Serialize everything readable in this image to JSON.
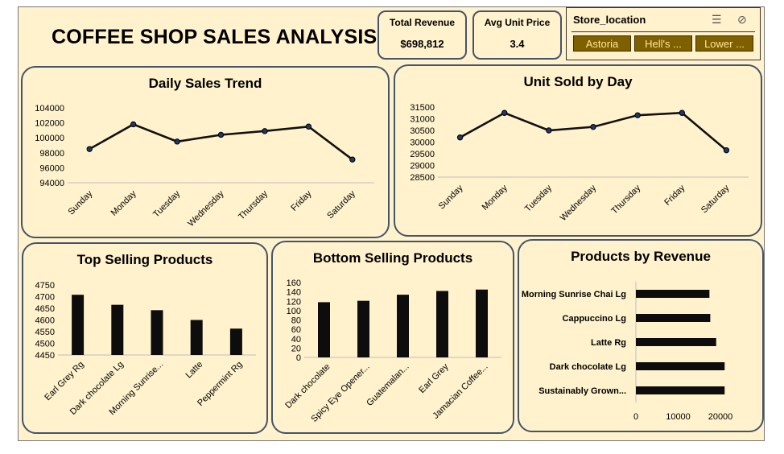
{
  "dashboard_title": "COFFEE SHOP SALES ANALYSIS",
  "kpis": {
    "total_revenue": {
      "label": "Total Revenue",
      "value": "$698,812"
    },
    "avg_unit_price": {
      "label": "Avg Unit Price",
      "value": "3.4"
    }
  },
  "slicer": {
    "header": "Store_location",
    "items": [
      "Astoria",
      "Hell's ...",
      "Lower ..."
    ]
  },
  "charts": {
    "daily_sales": {
      "title": "Daily Sales Trend"
    },
    "units_by_day": {
      "title": "Unit Sold by Day"
    },
    "top_products": {
      "title": "Top Selling Products"
    },
    "bottom_products": {
      "title": "Bottom Selling Products"
    },
    "products_revenue": {
      "title": "Products by Revenue"
    }
  },
  "chart_data": [
    {
      "id": "daily_sales",
      "type": "line",
      "title": "Daily Sales Trend",
      "categories": [
        "Sunday",
        "Monday",
        "Tuesday",
        "Wednesday",
        "Thursday",
        "Friday",
        "Saturday"
      ],
      "values": [
        98500,
        101800,
        99500,
        100400,
        100900,
        101500,
        97100
      ],
      "ylim": [
        94000,
        104000
      ],
      "yticks": [
        94000,
        96000,
        98000,
        100000,
        102000,
        104000
      ],
      "grid": false
    },
    {
      "id": "units_by_day",
      "type": "line",
      "title": "Unit Sold by Day",
      "categories": [
        "Sunday",
        "Monday",
        "Tuesday",
        "Wednesday",
        "Thursday",
        "Friday",
        "Saturday"
      ],
      "values": [
        30200,
        31250,
        30500,
        30650,
        31150,
        31250,
        29650
      ],
      "ylim": [
        28500,
        31500
      ],
      "yticks": [
        28500,
        29000,
        29500,
        30000,
        30500,
        31000,
        31500
      ],
      "grid": false
    },
    {
      "id": "top_products",
      "type": "bar",
      "title": "Top Selling Products",
      "categories": [
        "Earl Grey Rg",
        "Dark chocolate Lg",
        "Morning Sunrise...",
        "Latte",
        "Peppermint Rg"
      ],
      "values": [
        4708,
        4665,
        4642,
        4600,
        4563
      ],
      "ylim": [
        4450,
        4750
      ],
      "yticks": [
        4450,
        4500,
        4550,
        4600,
        4650,
        4700,
        4750
      ]
    },
    {
      "id": "bottom_products",
      "type": "bar",
      "title": "Bottom Selling Products",
      "categories": [
        "Dark chocolate",
        "Spicy Eye Opener...",
        "Guatemalan...",
        "Earl Grey",
        "Jamacian Coffee..."
      ],
      "values": [
        118,
        121,
        134,
        142,
        145
      ],
      "ylim": [
        0,
        160
      ],
      "yticks": [
        0,
        20,
        40,
        60,
        80,
        100,
        120,
        140,
        160
      ]
    },
    {
      "id": "products_revenue",
      "type": "bar",
      "orientation": "horizontal",
      "title": "Products by Revenue",
      "categories": [
        "Morning Sunrise Chai Lg",
        "Cappuccino Lg",
        "Latte Rg",
        "Dark chocolate Lg",
        "Sustainably Grown..."
      ],
      "values": [
        17400,
        17600,
        19000,
        21000,
        21000
      ],
      "xlim": [
        0,
        20000
      ],
      "xticks": [
        0,
        10000,
        20000
      ]
    }
  ]
}
